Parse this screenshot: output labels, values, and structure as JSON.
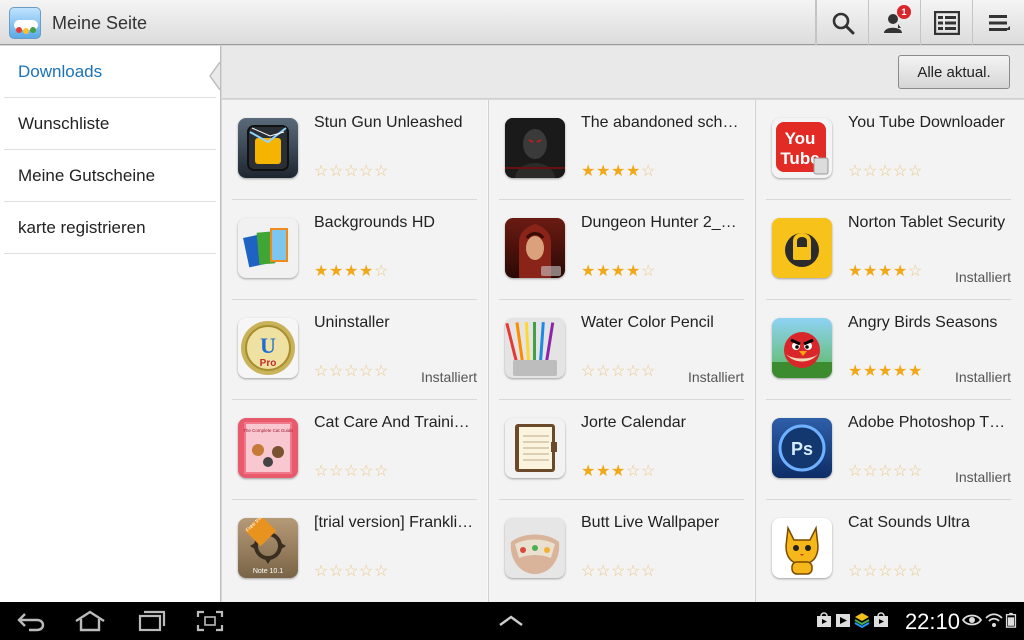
{
  "header": {
    "title": "Meine Seite",
    "app_icon": "cloud-market-icon",
    "notification_count": "1",
    "icons": [
      "search-icon",
      "account-icon",
      "list-view-icon",
      "menu-icon"
    ]
  },
  "sidebar": {
    "items": [
      {
        "label": "Downloads",
        "active": true
      },
      {
        "label": "Wunschliste",
        "active": false
      },
      {
        "label": "Meine Gutscheine",
        "active": false
      },
      {
        "label": "karte registrieren",
        "active": false
      }
    ]
  },
  "toolbar": {
    "update_all_label": "Alle aktual."
  },
  "apps": {
    "col1": [
      {
        "title": "Stun Gun Unleashed",
        "rating": 0,
        "status": ""
      },
      {
        "title": "Backgrounds HD",
        "rating": 4,
        "status": ""
      },
      {
        "title": "Uninstaller",
        "rating": 0,
        "status": "Installiert"
      },
      {
        "title": "Cat Care And Traini…",
        "rating": 0,
        "status": ""
      },
      {
        "title": "[trial version] Frankli…",
        "rating": 0,
        "status": ""
      }
    ],
    "col2": [
      {
        "title": "The abandoned sch…",
        "rating": 4,
        "status": ""
      },
      {
        "title": "Dungeon Hunter 2_…",
        "rating": 4,
        "status": ""
      },
      {
        "title": "Water Color Pencil",
        "rating": 0,
        "status": "Installiert"
      },
      {
        "title": "Jorte Calendar",
        "rating": 3,
        "status": ""
      },
      {
        "title": "Butt Live Wallpaper",
        "rating": 0,
        "status": ""
      }
    ],
    "col3": [
      {
        "title": "You Tube Downloader",
        "rating": 0,
        "status": ""
      },
      {
        "title": "Norton Tablet Security",
        "rating": 4,
        "status": "Installiert"
      },
      {
        "title": "Angry Birds Seasons",
        "rating": 5,
        "status": "Installiert"
      },
      {
        "title": "Adobe Photoshop T…",
        "rating": 0,
        "status": "Installiert"
      },
      {
        "title": "Cat Sounds Ultra",
        "rating": 0,
        "status": ""
      }
    ]
  },
  "icon_texts": {
    "youtube_you": "You",
    "youtube_tube": "Tube",
    "uninstaller_u": "U",
    "uninstaller_pro": "Pro",
    "catcare": "The Complete Cat Guide",
    "franklin_badge": "Free trial",
    "franklin_note": "Note 10.1",
    "photoshop": "Ps"
  },
  "statusbar": {
    "time": "22:10"
  },
  "colors": {
    "accent": "#1a73b8",
    "star": "#f0a818",
    "badge": "#d8262a"
  }
}
